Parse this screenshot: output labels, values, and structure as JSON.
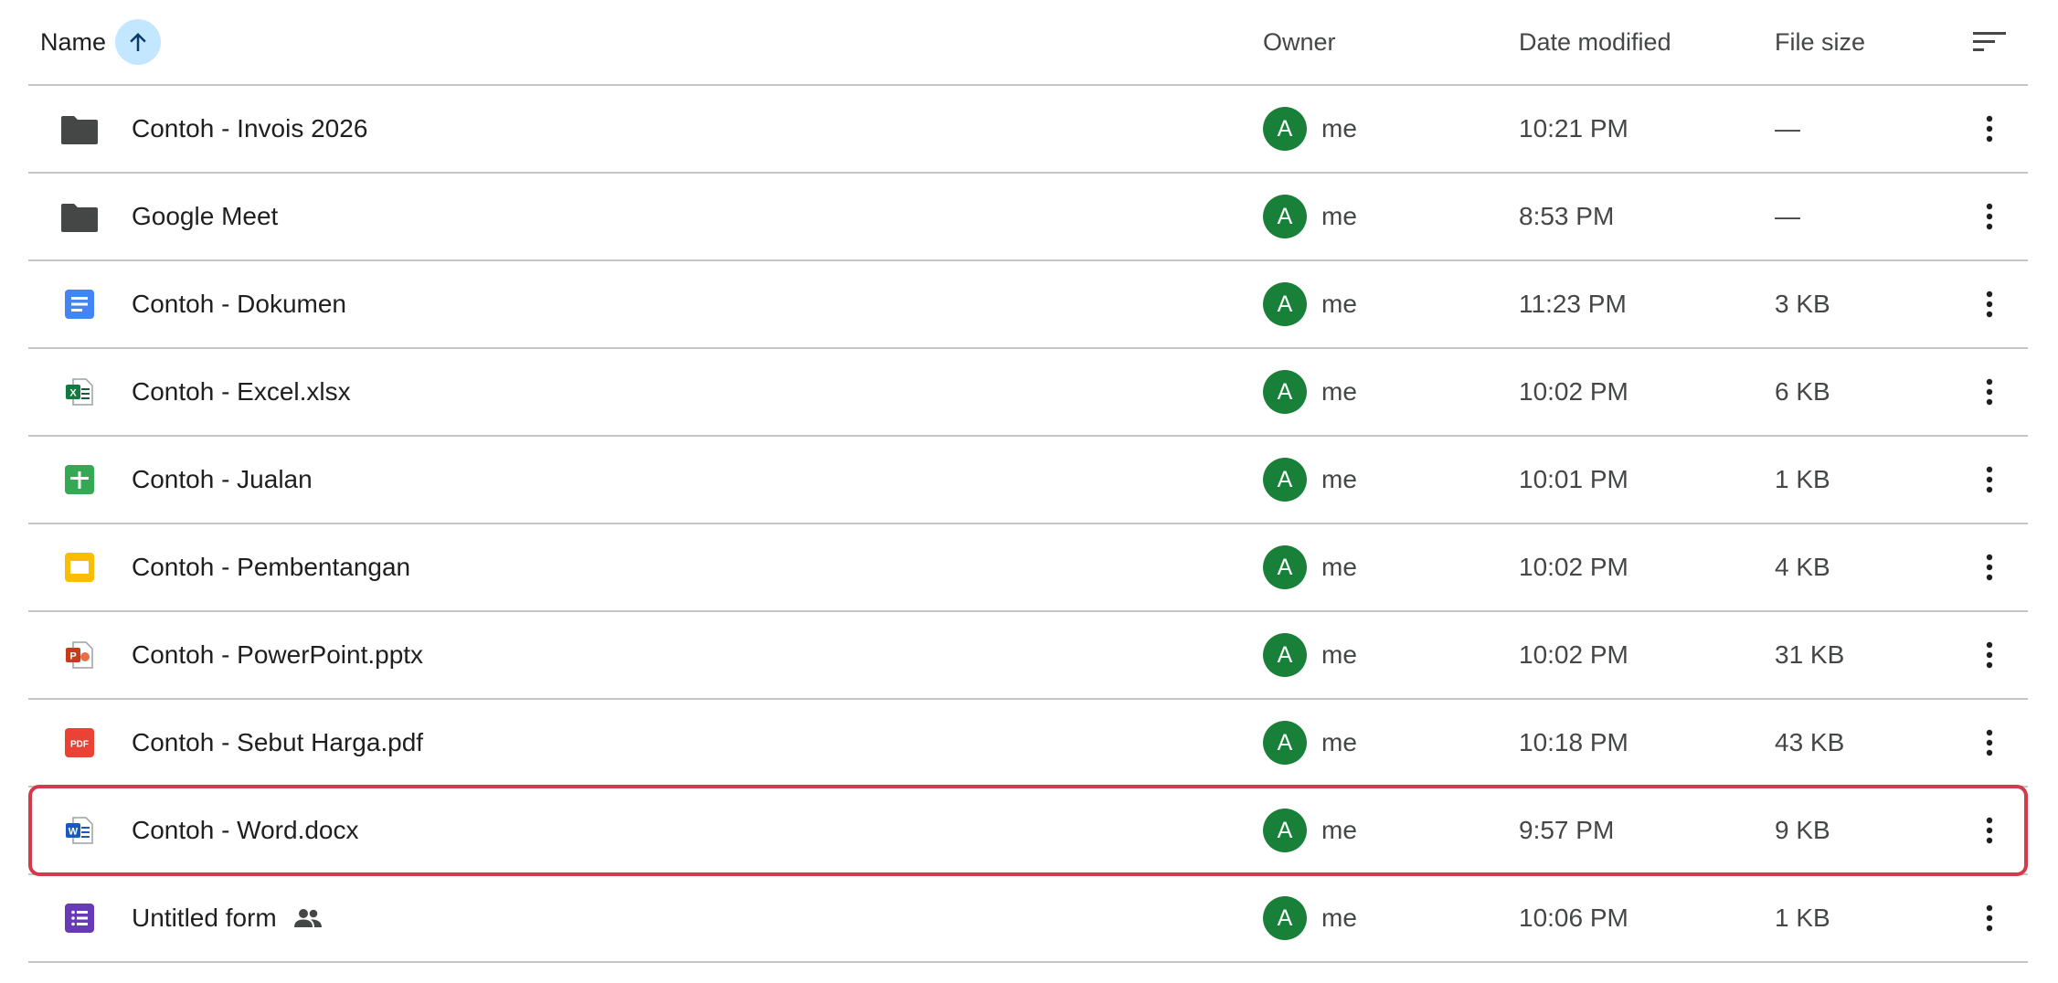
{
  "header": {
    "name": "Name",
    "owner": "Owner",
    "date_modified": "Date modified",
    "file_size": "File size",
    "sort_direction_icon": "arrow-up-icon",
    "sort_options_icon": "sort-lines-icon"
  },
  "colors": {
    "folder": "#444746",
    "docs": "#4285f4",
    "sheets": "#34a853",
    "slides": "#fbbc04",
    "pdf": "#ea4335",
    "forms": "#673ab7",
    "avatar": "#188038",
    "selection_outline": "#d33b4a",
    "sort_button": "#c2e7ff"
  },
  "rows": [
    {
      "name": "Contoh - Invois 2026",
      "icon": "folder-icon",
      "owner_initial": "A",
      "owner": "me",
      "date": "10:21 PM",
      "size": "—"
    },
    {
      "name": "Google Meet",
      "icon": "folder-icon",
      "owner_initial": "A",
      "owner": "me",
      "date": "8:53 PM",
      "size": "—"
    },
    {
      "name": "Contoh - Dokumen",
      "icon": "google-docs-icon",
      "owner_initial": "A",
      "owner": "me",
      "date": "11:23 PM",
      "size": "3 KB"
    },
    {
      "name": "Contoh - Excel.xlsx",
      "icon": "excel-icon",
      "owner_initial": "A",
      "owner": "me",
      "date": "10:02 PM",
      "size": "6 KB"
    },
    {
      "name": "Contoh - Jualan",
      "icon": "google-sheets-icon",
      "owner_initial": "A",
      "owner": "me",
      "date": "10:01 PM",
      "size": "1 KB"
    },
    {
      "name": "Contoh - Pembentangan",
      "icon": "google-slides-icon",
      "owner_initial": "A",
      "owner": "me",
      "date": "10:02 PM",
      "size": "4 KB"
    },
    {
      "name": "Contoh - PowerPoint.pptx",
      "icon": "powerpoint-icon",
      "owner_initial": "A",
      "owner": "me",
      "date": "10:02 PM",
      "size": "31 KB"
    },
    {
      "name": "Contoh - Sebut Harga.pdf",
      "icon": "pdf-icon",
      "owner_initial": "A",
      "owner": "me",
      "date": "10:18 PM",
      "size": "43 KB"
    },
    {
      "name": "Contoh - Word.docx",
      "icon": "word-icon",
      "owner_initial": "A",
      "owner": "me",
      "date": "9:57 PM",
      "size": "9 KB",
      "selected": true
    },
    {
      "name": "Untitled form",
      "icon": "google-forms-icon",
      "owner_initial": "A",
      "owner": "me",
      "date": "10:06 PM",
      "size": "1 KB",
      "shared": true,
      "shared_icon": "shared-people-icon"
    }
  ],
  "row_menu_icon": "more-vert-icon"
}
